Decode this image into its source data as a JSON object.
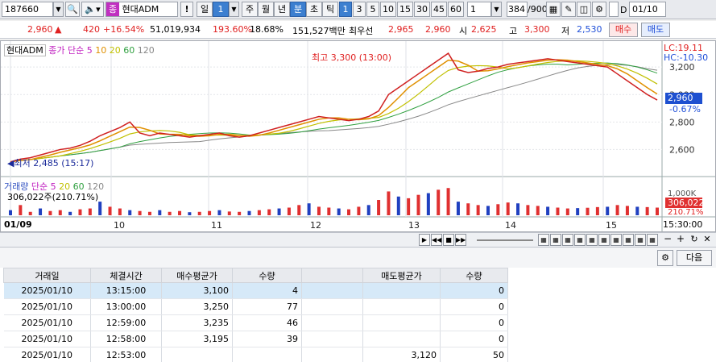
{
  "toolbar": {
    "code": "187660",
    "search_icon": "search-icon",
    "stock_badge": "종",
    "stock_name": "현대ADM",
    "bang": "!",
    "period_day": "일",
    "period_value": "1",
    "periods": [
      "주",
      "월",
      "년"
    ],
    "minute": "분",
    "others": [
      "초",
      "틱"
    ],
    "intervals": [
      "1",
      "3",
      "5",
      "10",
      "15",
      "30",
      "45",
      "60"
    ],
    "interval_value": "1",
    "count_current": "384",
    "count_total": "/900",
    "d_label": "D",
    "date": "01/10"
  },
  "quote": {
    "price": "2,960",
    "arrow": "▲",
    "change": "420",
    "change_pct": "+16.54%",
    "volume": "51,019,934",
    "vol_ratio": "193.60%",
    "turnover": "18.68%",
    "amount": "151,527백만",
    "priority_label": "최우선",
    "ask": "2,965",
    "bid": "2,960",
    "open_label": "시",
    "open": "2,625",
    "high_label": "고",
    "high": "3,300",
    "low_label": "저",
    "low": "2,530",
    "buy": "매수",
    "sell": "매도"
  },
  "chart_data": {
    "type": "line",
    "price_legend": {
      "name": "현대ADM",
      "ma_label": "종가 단순",
      "ma": [
        "5",
        "10",
        "20",
        "60",
        "120"
      ]
    },
    "volume_legend": {
      "name": "거래량",
      "ma_label": "단순",
      "ma": [
        "5",
        "20",
        "60",
        "120"
      ],
      "value": "306,022주(210.71%)"
    },
    "annotations": {
      "high": "최고 3,300 (13:00)",
      "low": "최저 2,485 (15:17)"
    },
    "lc": "LC:19.11",
    "hc": "HC:-10.30",
    "y_ticks": [
      "3,200",
      "3,000",
      "2,800",
      "2,600"
    ],
    "y_tick_values": [
      3200,
      3000,
      2800,
      2600
    ],
    "current_price": "2,960",
    "current_pct": "-0.67%",
    "vol_ticks": [
      "1,000K"
    ],
    "vol_current": "306,022",
    "vol_pct": "210.71%",
    "x_labels": [
      "01/09",
      "10",
      "11",
      "12",
      "13",
      "14",
      "15"
    ],
    "time_label": "15:30:00",
    "price_series": [
      2510,
      2530,
      2540,
      2560,
      2580,
      2600,
      2610,
      2630,
      2660,
      2700,
      2730,
      2760,
      2800,
      2720,
      2700,
      2720,
      2710,
      2700,
      2690,
      2700,
      2710,
      2720,
      2700,
      2690,
      2700,
      2720,
      2740,
      2760,
      2780,
      2800,
      2820,
      2840,
      2830,
      2820,
      2810,
      2820,
      2840,
      2880,
      3000,
      3050,
      3100,
      3150,
      3200,
      3250,
      3300,
      3180,
      3160,
      3170,
      3190,
      3200,
      3220,
      3230,
      3240,
      3250,
      3260,
      3250,
      3240,
      3230,
      3220,
      3210,
      3200,
      3150,
      3100,
      3050,
      3000,
      2960
    ],
    "price_min": 2450,
    "price_max": 3330,
    "volume_series": [
      30,
      60,
      20,
      40,
      25,
      30,
      20,
      35,
      40,
      80,
      50,
      40,
      30,
      25,
      20,
      30,
      20,
      25,
      18,
      20,
      25,
      30,
      22,
      20,
      25,
      30,
      35,
      40,
      45,
      60,
      70,
      50,
      45,
      40,
      35,
      50,
      60,
      90,
      140,
      110,
      100,
      120,
      130,
      150,
      160,
      80,
      70,
      60,
      55,
      65,
      75,
      70,
      60,
      55,
      50,
      45,
      40,
      42,
      44,
      48,
      50,
      60,
      55,
      50,
      48,
      45
    ],
    "vol_max": 180
  },
  "table": {
    "columns": [
      "거래일",
      "체결시간",
      "매수평균가",
      "수량",
      "",
      "매도평균가",
      "수량"
    ],
    "rows": [
      [
        "2025/01/10",
        "13:15:00",
        "3,100",
        "4",
        "",
        "",
        "0"
      ],
      [
        "2025/01/10",
        "13:00:00",
        "3,250",
        "77",
        "",
        "",
        "0"
      ],
      [
        "2025/01/10",
        "12:59:00",
        "3,235",
        "46",
        "",
        "",
        "0"
      ],
      [
        "2025/01/10",
        "12:58:00",
        "3,195",
        "39",
        "",
        "",
        "0"
      ],
      [
        "2025/01/10",
        "12:53:00",
        "",
        "",
        "",
        "3,120",
        "50"
      ]
    ],
    "next_button": "다음"
  }
}
